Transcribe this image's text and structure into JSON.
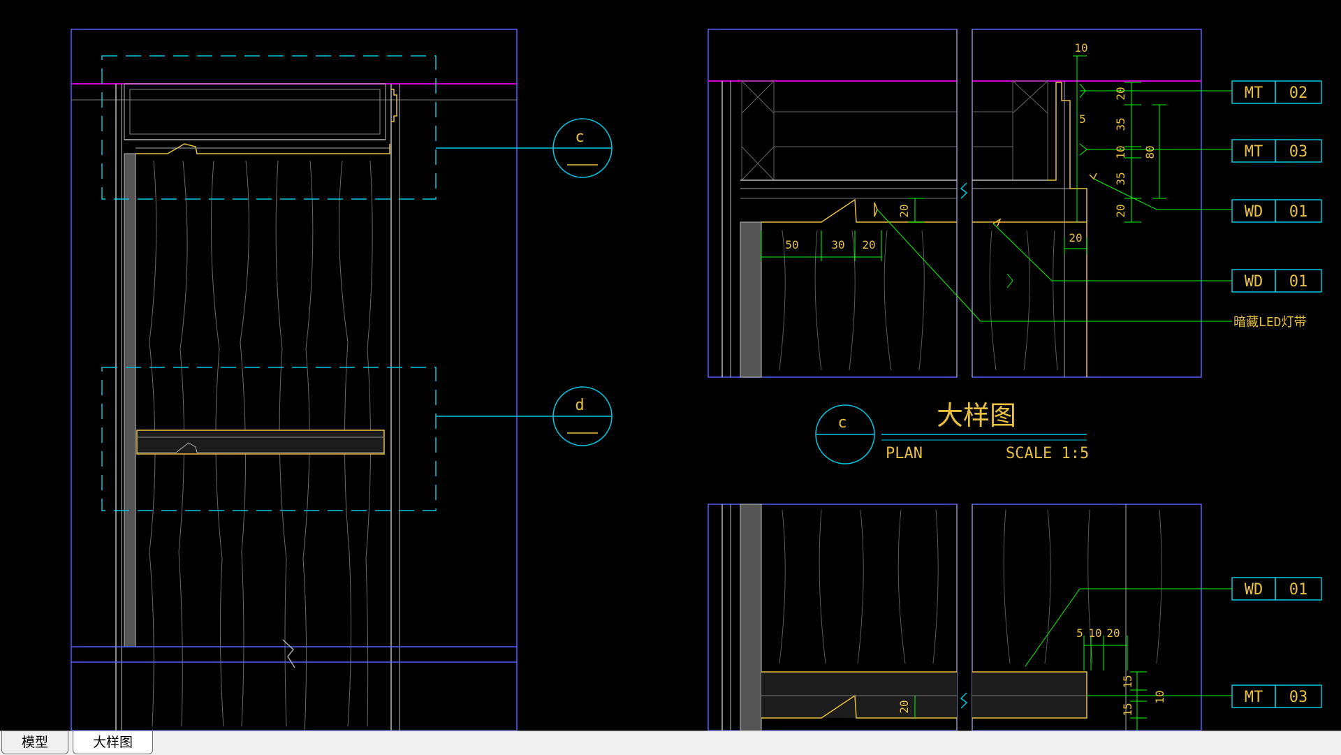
{
  "tabs": [
    {
      "label": "模型",
      "active": false
    },
    {
      "label": "大样图",
      "active": true
    }
  ],
  "callouts": {
    "c": {
      "letter": "c"
    },
    "d": {
      "letter": "d"
    }
  },
  "title_block": {
    "letter": "c",
    "title": "大样图",
    "view": "PLAN",
    "scale": "SCALE 1:5"
  },
  "tags": [
    {
      "code": "MT",
      "number": "02"
    },
    {
      "code": "MT",
      "number": "03"
    },
    {
      "code": "WD",
      "number": "01"
    },
    {
      "code": "WD",
      "number": "01"
    },
    {
      "code": "WD",
      "number": "01"
    },
    {
      "code": "MT",
      "number": "03"
    }
  ],
  "notes": {
    "led_strip": "暗藏LED灯带"
  },
  "dimensions": {
    "top_right": [
      "10",
      "20",
      "5",
      "35",
      "10",
      "80",
      "35",
      "20",
      "20"
    ],
    "shelf_top": [
      "20",
      "50",
      "30",
      "20"
    ],
    "bottom": [
      "5",
      "10",
      "20",
      "15",
      "10",
      "15",
      "20"
    ]
  },
  "colors": {
    "background": "#000000",
    "frame": "#5560ff",
    "cyan": "#00c8e0",
    "yellow": "#e8c040",
    "green": "#00ff00",
    "magenta": "#d000d0",
    "white": "#e8e8e8",
    "gray": "#7c7c7c"
  }
}
